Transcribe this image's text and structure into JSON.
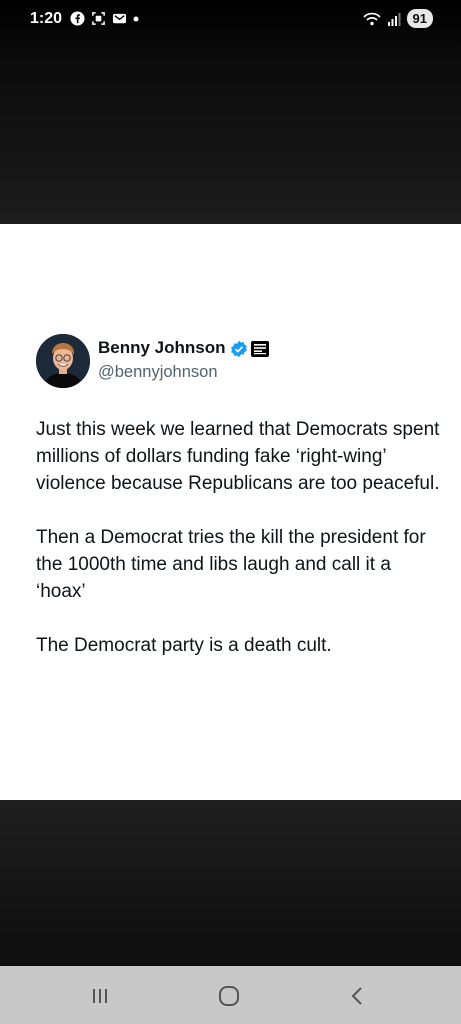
{
  "status_bar": {
    "time": "1:20",
    "left_icons": [
      "facebook-icon",
      "screenshot-icon",
      "mail-icon",
      "dot-icon"
    ],
    "right_icons": [
      "wifi-icon",
      "signal-icon"
    ],
    "battery": "91"
  },
  "tweet": {
    "author_name": "Benny Johnson",
    "handle": "@bennyjohnson",
    "verified": true,
    "paragraphs": [
      "Just this week we learned that Democrats spent millions of dollars funding fake ‘right-wing’ violence because Republicans are too peaceful.",
      "Then a Democrat tries the kill the president for the 1000th time and libs laugh and call it a ‘hoax’",
      "The Democrat party is a death cult."
    ]
  },
  "nav_bar": {
    "buttons": [
      "recent-apps-icon",
      "home-icon",
      "back-icon"
    ]
  },
  "colors": {
    "verified_blue": "#1d9bf0",
    "panel_bg": "#ffffff",
    "nav_bg": "#c8c8c8"
  }
}
